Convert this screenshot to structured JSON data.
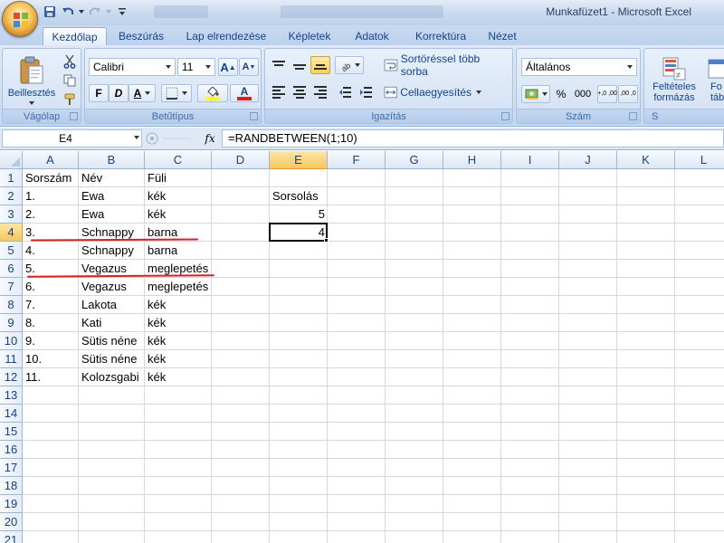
{
  "window": {
    "title": "Munkafüzet1 - Microsoft Excel"
  },
  "quick_access": {
    "icons": [
      "save-icon",
      "undo-icon",
      "redo-icon",
      "customize-icon"
    ]
  },
  "ribbon": {
    "tabs": [
      "Kezdőlap",
      "Beszúrás",
      "Lap elrendezése",
      "Képletek",
      "Adatok",
      "Korrektúra",
      "Nézet"
    ],
    "active_tab": "Kezdőlap",
    "clipboard": {
      "group_label": "Vágólap",
      "paste_label": "Beillesztés"
    },
    "font": {
      "group_label": "Betűtípus",
      "font_name": "Calibri",
      "font_size": "11",
      "grow_label": "A",
      "shrink_label": "A",
      "bold_label": "F",
      "italic_label": "D",
      "underline_label": "A",
      "font_color_label": "A",
      "font_color": "#d9201e",
      "fill_color": "#ffff00"
    },
    "alignment": {
      "group_label": "Igazítás",
      "wrap_text": "Sortöréssel több sorba",
      "merge_center": "Cellaegyesítés"
    },
    "number": {
      "group_label": "Szám",
      "format": "Általános",
      "percent": "%",
      "thousands": "000",
      "inc_decimal": "+,0 ,00",
      "dec_decimal": ",00 ,0"
    },
    "styles": {
      "group_label": "S",
      "conditional_line1": "Feltételes",
      "conditional_line2": "formázás",
      "table_line1": "Fo",
      "table_line2": "táblá"
    }
  },
  "formula_bar": {
    "name_box": "E4",
    "fx_label": "fx",
    "formula": "=RANDBETWEEN(1;10)"
  },
  "sheet": {
    "columns": [
      "A",
      "B",
      "C",
      "D",
      "E",
      "F",
      "G",
      "H",
      "I",
      "J",
      "K",
      "L"
    ],
    "rows": [
      "1",
      "2",
      "3",
      "4",
      "5",
      "6",
      "7",
      "8",
      "9",
      "10",
      "11",
      "12",
      "13",
      "14",
      "15",
      "16",
      "17",
      "18",
      "19",
      "20",
      "21"
    ],
    "selected_column": "E",
    "selected_row": "4",
    "header_row": {
      "A": "Sorszám",
      "B": "Név",
      "C": "Füli"
    },
    "data": [
      {
        "A": "1.",
        "B": "Ewa",
        "C": "kék"
      },
      {
        "A": "2.",
        "B": "Ewa",
        "C": "kék"
      },
      {
        "A": "3.",
        "B": "Schnappy",
        "C": "barna"
      },
      {
        "A": "4.",
        "B": "Schnappy",
        "C": "barna"
      },
      {
        "A": "5.",
        "B": "Vegazus",
        "C": "meglepetés"
      },
      {
        "A": "6.",
        "B": "Vegazus",
        "C": "meglepetés"
      },
      {
        "A": "7.",
        "B": "Lakota",
        "C": "kék"
      },
      {
        "A": "8.",
        "B": "Kati",
        "C": "kék"
      },
      {
        "A": "9.",
        "B": "Sütis néne",
        "C": "kék"
      },
      {
        "A": "10.",
        "B": "Sütis néne",
        "C": "kék"
      },
      {
        "A": "11.",
        "B": "Kolozsgabi",
        "C": "kék"
      }
    ],
    "sorsolas": {
      "label": "Sorsolás",
      "value_row3": "5",
      "value_row4": "4"
    },
    "annotation_color": "#d9201e"
  }
}
